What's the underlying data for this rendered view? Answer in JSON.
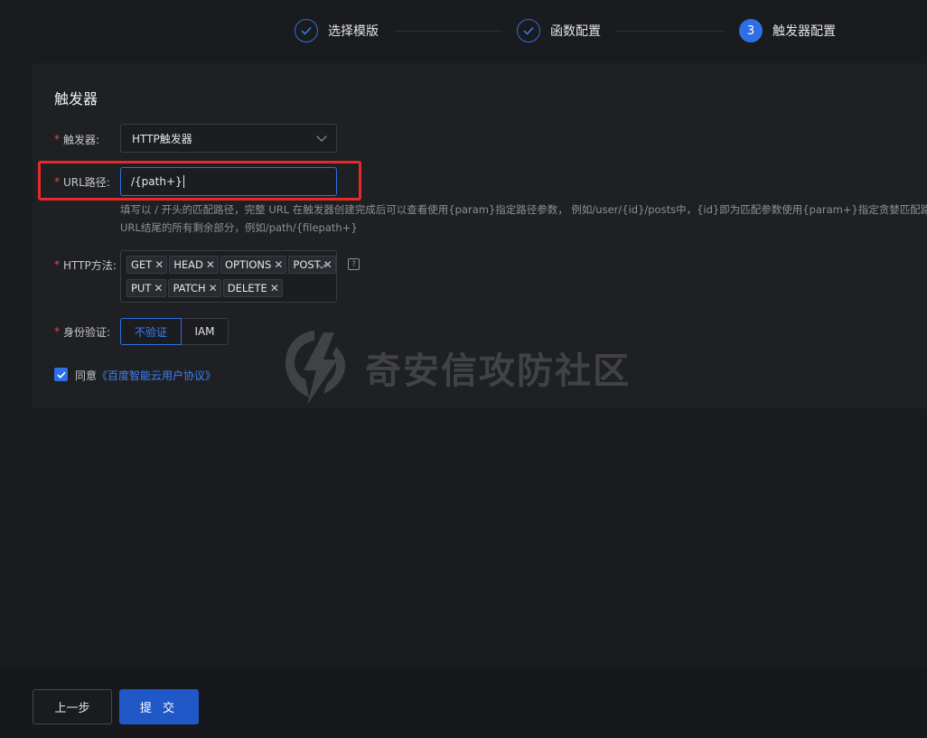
{
  "steps": [
    {
      "index": "1",
      "label": "选择模版",
      "state": "done"
    },
    {
      "index": "2",
      "label": "函数配置",
      "state": "done"
    },
    {
      "index": "3",
      "label": "触发器配置",
      "state": "active"
    }
  ],
  "card": {
    "title": "触发器",
    "trigger": {
      "label": "触发器:",
      "value": "HTTP触发器"
    },
    "url_path": {
      "label": "URL路径:",
      "value": "/{path+}",
      "hint_line1": "填写以 / 开头的匹配路径，完整 URL 在触发器创建完成后可以查看使用{param}指定路径参数， 例如/user/{id}/posts中，{id}即为匹配参数使用{param+}指定贪婪匹配路径参",
      "hint_line2": "URL结尾的所有剩余部分，例如/path/{filepath+}"
    },
    "http_method": {
      "label": "HTTP方法:",
      "row1": [
        "GET",
        "HEAD",
        "OPTIONS",
        "POST"
      ],
      "row2": [
        "PUT",
        "PATCH",
        "DELETE"
      ],
      "help": "?"
    },
    "auth": {
      "label": "身份验证:",
      "options": [
        "不验证",
        "IAM"
      ],
      "selected": "不验证"
    },
    "agree": {
      "prefix": "同意",
      "link": "《百度智能云用户协议》",
      "checked": true
    }
  },
  "watermark": "奇安信攻防社区",
  "footer": {
    "prev": "上一步",
    "submit": "提 交"
  },
  "colors": {
    "accent": "#2f6fe4",
    "required": "#f0483e",
    "highlight": "#e52a2a"
  },
  "icons": {
    "done": "check-icon",
    "dropdown": "chevron-down-icon",
    "remove": "close-icon"
  }
}
